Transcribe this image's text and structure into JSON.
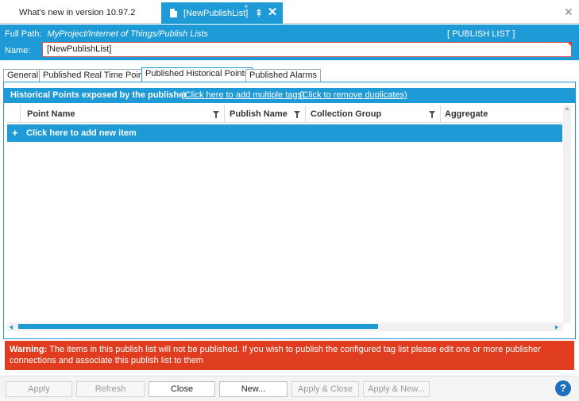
{
  "doc_tabs": {
    "inactive_tab": "What's new in version 10.97.2",
    "active_tab": "[NewPublishList]",
    "modified_mark": "*",
    "pin_glyph": "⇞",
    "close_glyph": "✕",
    "window_close_glyph": "✕"
  },
  "header": {
    "full_path_label": "Full Path:",
    "full_path_value": "MyProject/Internet of Things/Publish Lists",
    "list_type": "[ PUBLISH LIST ]",
    "name_label": "Name:",
    "name_value": "[NewPublishList]"
  },
  "prop_tabs": [
    {
      "label": "General"
    },
    {
      "label": "Published Real Time Points"
    },
    {
      "label": "Published Historical Points"
    },
    {
      "label": "Published Alarms"
    }
  ],
  "active_prop_tab": "Published Historical Points",
  "grid": {
    "caption": "Historical Points exposed by the publisher",
    "link_add_multiple": "(Click here to add multiple tags)",
    "link_remove_duplicates": "(Click to remove duplicates)",
    "columns": [
      "Point Name",
      "Publish Name",
      "Collection Group",
      "Aggregate"
    ],
    "add_row_plus": "+",
    "add_row_text": "Click here to add new item"
  },
  "warning": {
    "prefix": "Warning:",
    "text": " The items in this publish list will not be published. If you wish to publish the configured tag list please edit one or more publisher connections and associate this publish list to them"
  },
  "buttons": {
    "apply": "Apply",
    "refresh": "Refresh",
    "close": "Close",
    "new": "New...",
    "apply_close": "Apply & Close",
    "apply_new": "Apply & New...",
    "help": "?"
  },
  "colors": {
    "accent": "#1e9ad6",
    "warning": "#e03c1f",
    "help": "#1e6fbd"
  }
}
